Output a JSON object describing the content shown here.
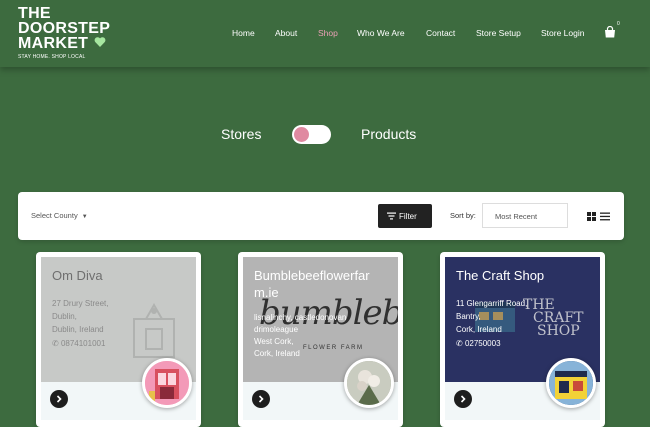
{
  "header": {
    "logo": {
      "line1": "THE",
      "line2": "DOORSTEP",
      "line3": "MARKET",
      "tagline": "STAY HOME. SHOP LOCAL"
    },
    "nav": [
      {
        "label": "Home",
        "active": false
      },
      {
        "label": "About",
        "active": false
      },
      {
        "label": "Shop",
        "active": true
      },
      {
        "label": "Who We Are",
        "active": false
      },
      {
        "label": "Contact",
        "active": false
      },
      {
        "label": "Store Setup",
        "active": false
      },
      {
        "label": "Store Login",
        "active": false
      }
    ],
    "cart_count": "0"
  },
  "toggle": {
    "left_label": "Stores",
    "right_label": "Products",
    "active": "Stores"
  },
  "filter_bar": {
    "county_label": "Select County",
    "filter_button": "Filter",
    "sort_label": "Sort by:",
    "sort_value": "Most Recent"
  },
  "stores": [
    {
      "name": "Om Diva",
      "address": [
        "27 Drury Street,",
        "Dublin,",
        "Dublin, Ireland"
      ],
      "phone": "0874101001"
    },
    {
      "name": "Bumblebeeflowerfar m.ie",
      "address": [
        "lisnalinchy, castledonovan",
        "drimoleague",
        "West Cork,",
        "Cork, Ireland"
      ],
      "phone": ""
    },
    {
      "name": "The Craft Shop",
      "address": [
        "11 Glengarriff Road,",
        "Bantry,",
        "Cork, Ireland"
      ],
      "phone": "02750003"
    }
  ],
  "images": {
    "store2_banner_text": "bumblebee",
    "store2_banner_sub": "FLOWER FARM",
    "store3_banner_line1": "THE",
    "store3_banner_line2": "CRAFT",
    "store3_banner_line3": "SHOP"
  },
  "colors": {
    "background": "#3d6b3f",
    "nav_active": "#e9a0b4",
    "toggle_knob": "#e08aa1",
    "heart": "#a6e6a0"
  }
}
